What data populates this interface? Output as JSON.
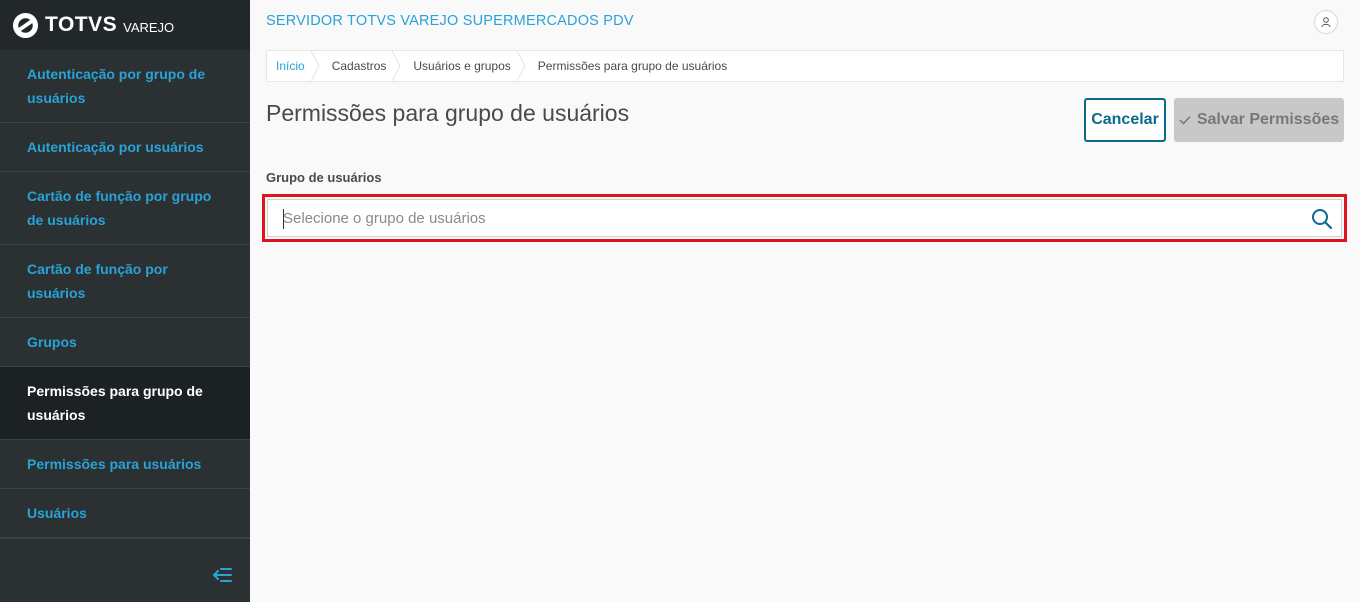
{
  "brand": {
    "name": "TOTVS",
    "sub": "VAREJO"
  },
  "sidebar": {
    "items": [
      {
        "label": "Autenticação por grupo de usuários",
        "active": false
      },
      {
        "label": "Autenticação por usuários",
        "active": false
      },
      {
        "label": "Cartão de função por grupo de usuários",
        "active": false
      },
      {
        "label": "Cartão de função por usuários",
        "active": false
      },
      {
        "label": "Grupos",
        "active": false
      },
      {
        "label": "Permissões para grupo de usuários",
        "active": true
      },
      {
        "label": "Permissões para usuários",
        "active": false
      },
      {
        "label": "Usuários",
        "active": false
      }
    ]
  },
  "header": {
    "server_title": "SERVIDOR TOTVS VAREJO SUPERMERCADOS PDV"
  },
  "breadcrumb": [
    "Início",
    "Cadastros",
    "Usuários e grupos",
    "Permissões para grupo de usuários"
  ],
  "page": {
    "title": "Permissões para grupo de usuários",
    "cancel_label": "Cancelar",
    "save_label": "Salvar Permissões",
    "field_label": "Grupo de usuários",
    "search_placeholder": "Selecione o grupo de usuários",
    "search_value": ""
  },
  "colors": {
    "accent": "#29a3d6",
    "sidebar_bg": "#2b3033",
    "highlight": "#e0141e",
    "primary_dark": "#0c6a8f"
  }
}
